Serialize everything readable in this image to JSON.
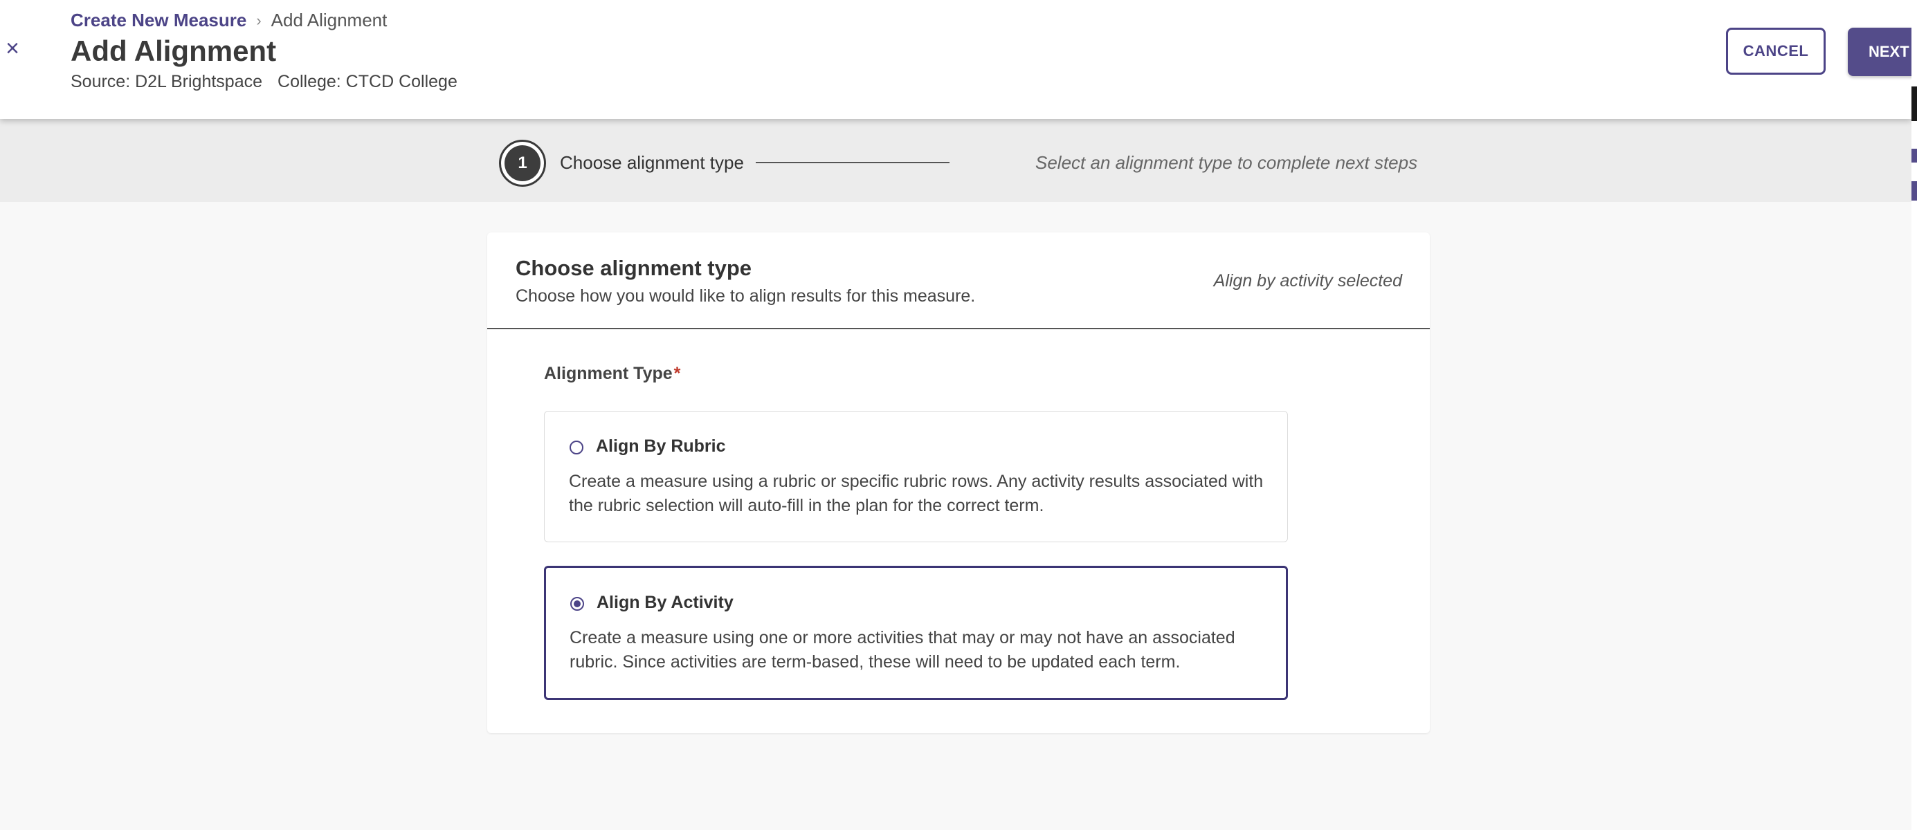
{
  "header": {
    "close_icon": "close-icon",
    "breadcrumb": {
      "parent": "Create New Measure",
      "separator_icon": "chevron-right-icon",
      "current": "Add Alignment"
    },
    "title": "Add Alignment",
    "source": "Source: D2L Brightspace",
    "college": "College: CTCD College",
    "cancel_label": "CANCEL",
    "next_label": "NEXT"
  },
  "stepper": {
    "step_number": "1",
    "step_label": "Choose alignment type",
    "hint": "Select an alignment type to complete next steps"
  },
  "card": {
    "title": "Choose alignment type",
    "subtitle": "Choose how you would like to align results for this measure.",
    "status": "Align by activity selected",
    "field_label": "Alignment Type",
    "required_marker": "*",
    "options": [
      {
        "title": "Align By Rubric",
        "description": "Create a measure using a rubric or specific rubric rows. Any activity results associated with the rubric selection will auto-fill in the plan for the correct term.",
        "selected": false
      },
      {
        "title": "Align By Activity",
        "description": "Create a measure using one or more activities that may or may not have an associated rubric. Since activities are term-based, these will need to be updated each term.",
        "selected": true
      }
    ]
  },
  "colors": {
    "accent": "#4c4487",
    "button_fill": "#544c8a",
    "required": "#c0392b"
  }
}
